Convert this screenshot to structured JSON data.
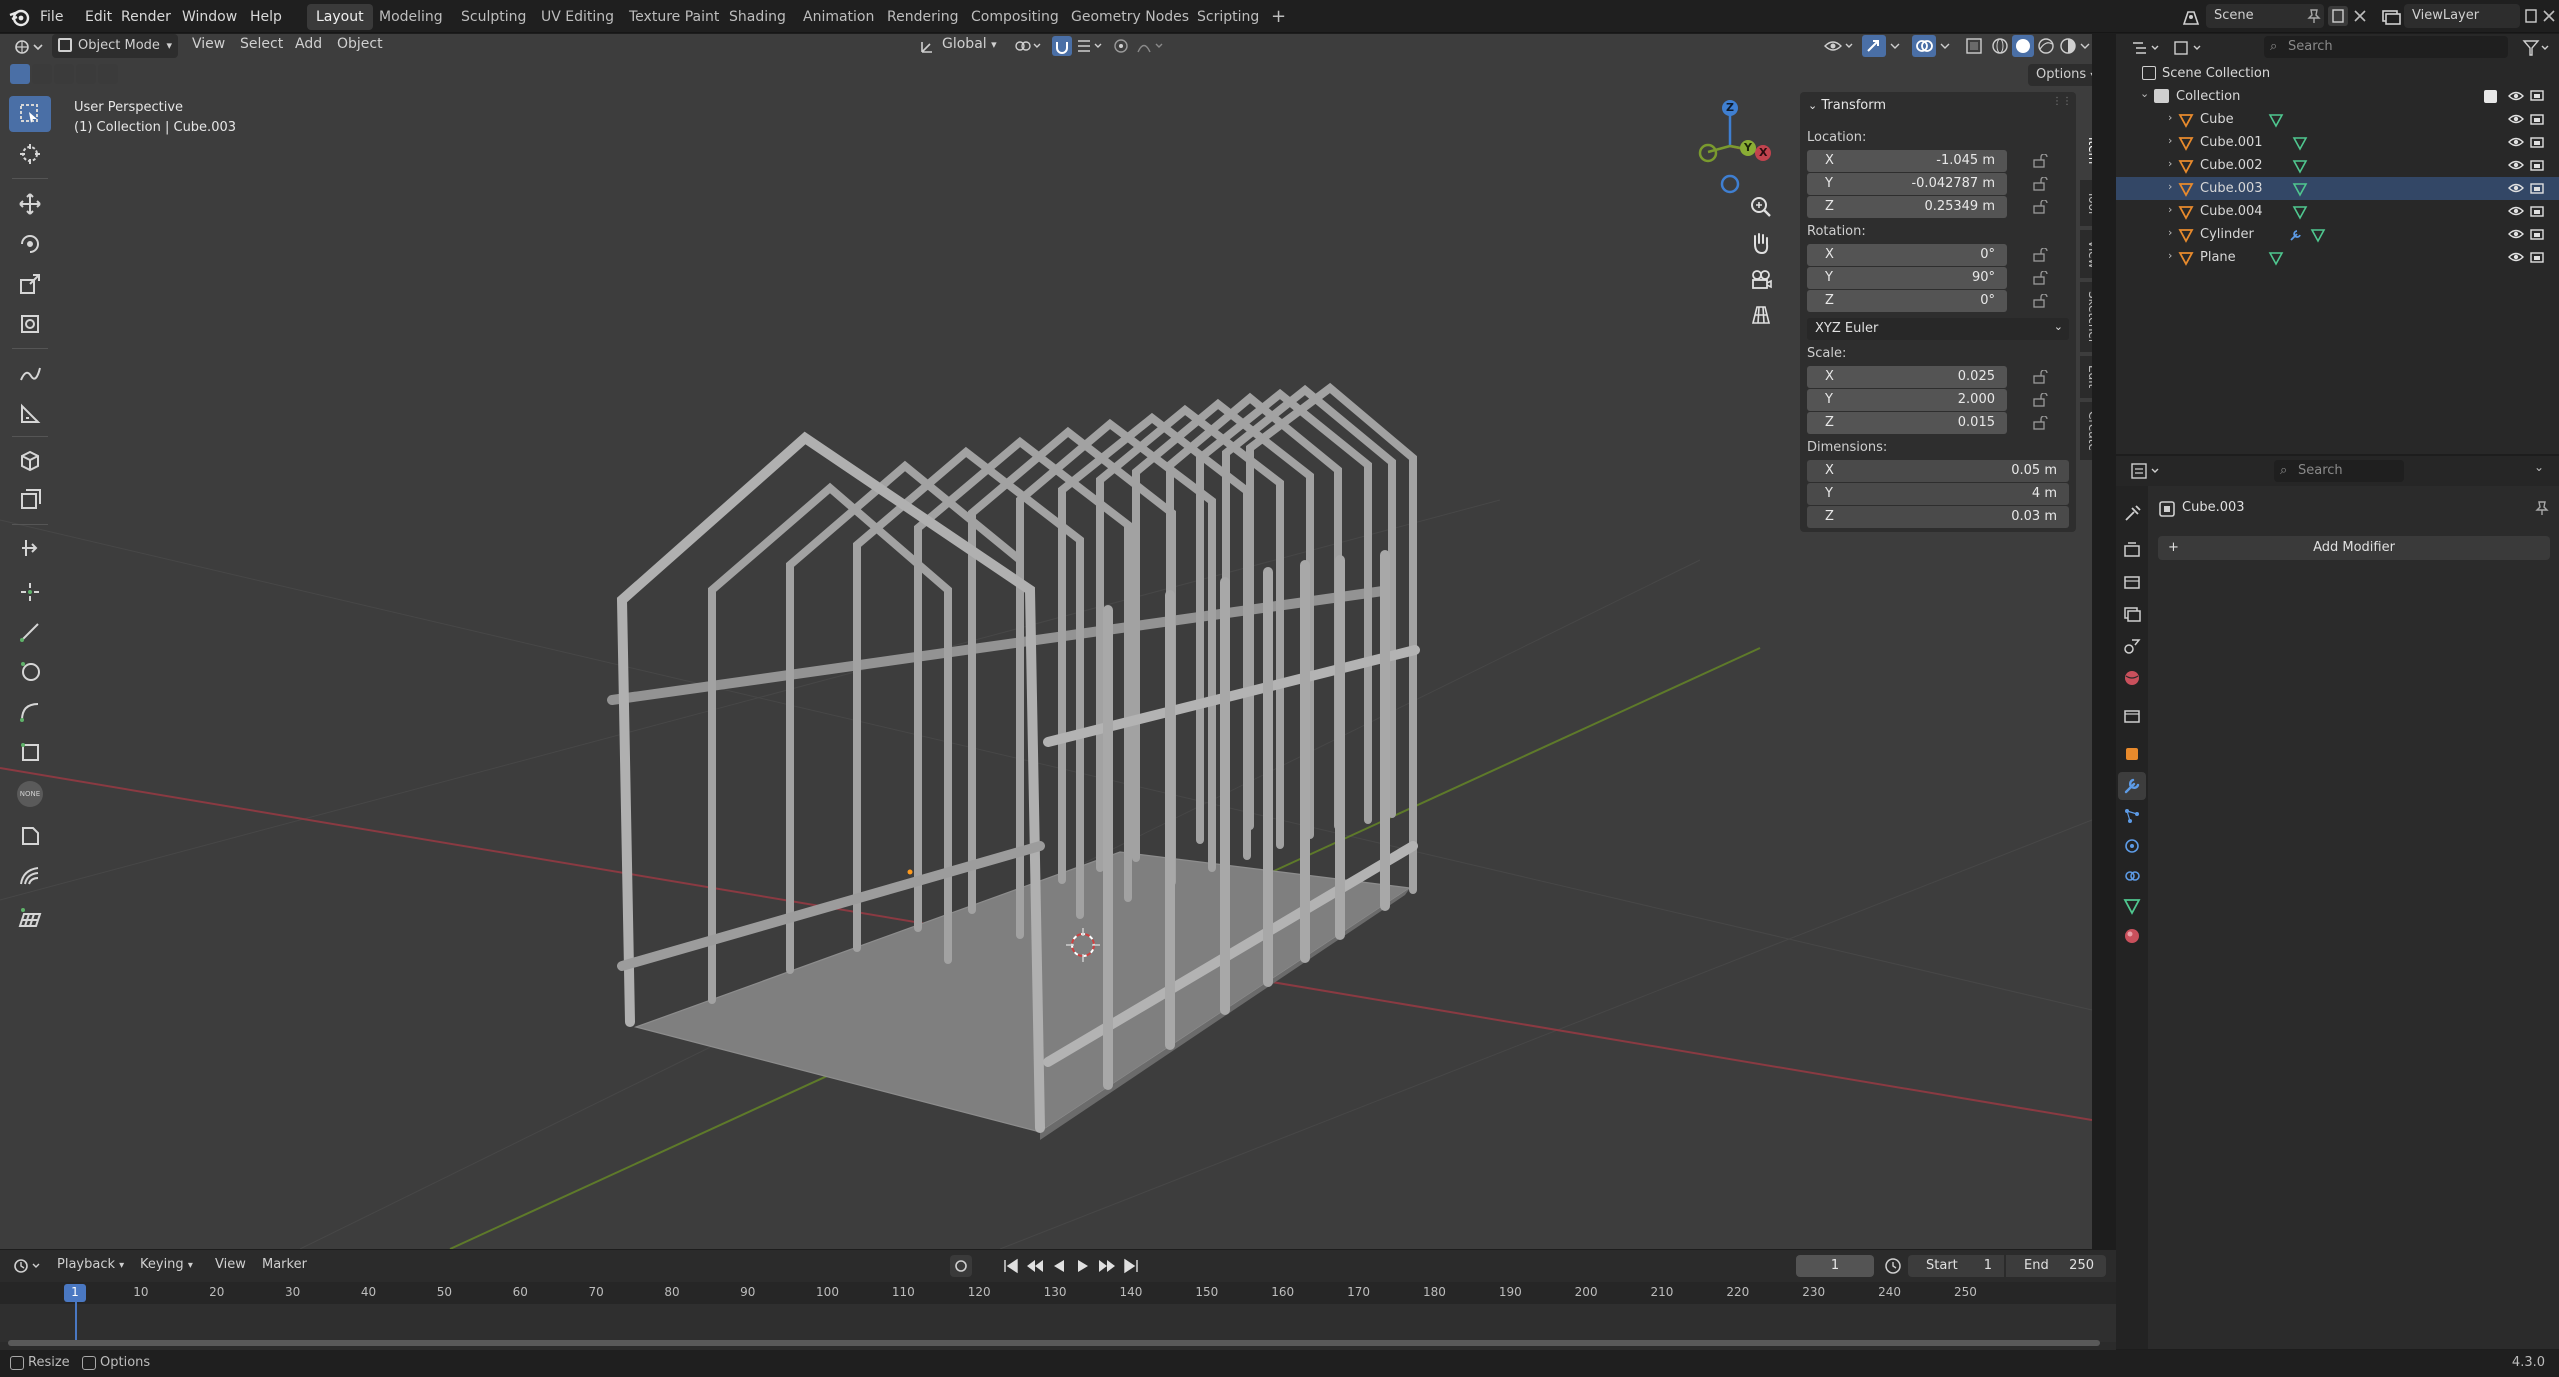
{
  "topbar": {
    "menus": [
      "File",
      "Edit",
      "Render",
      "Window",
      "Help"
    ],
    "workspaces": [
      "Layout",
      "Modeling",
      "Sculpting",
      "UV Editing",
      "Texture Paint",
      "Shading",
      "Animation",
      "Rendering",
      "Compositing",
      "Geometry Nodes",
      "Scripting"
    ],
    "active_workspace": "Layout",
    "add_tab": "+",
    "scene": "Scene",
    "view_layer": "ViewLayer"
  },
  "viewport_header": {
    "mode": "Object Mode",
    "menus": [
      "View",
      "Select",
      "Add",
      "Object"
    ],
    "transform_orientation": "Global",
    "options": "Options"
  },
  "viewport": {
    "perspective_label": "User Perspective",
    "collection_label": "(1) Collection | Cube.003",
    "gizmo": {
      "x": "X",
      "y": "Y",
      "z": "Z"
    }
  },
  "npanel": {
    "section": "Transform",
    "location_label": "Location:",
    "location": [
      {
        "axis": "X",
        "value": "-1.045 m"
      },
      {
        "axis": "Y",
        "value": "-0.042787 m"
      },
      {
        "axis": "Z",
        "value": "0.25349 m"
      }
    ],
    "rotation_label": "Rotation:",
    "rotation": [
      {
        "axis": "X",
        "value": "0°"
      },
      {
        "axis": "Y",
        "value": "90°"
      },
      {
        "axis": "Z",
        "value": "0°"
      }
    ],
    "rotation_mode": "XYZ Euler",
    "scale_label": "Scale:",
    "scale": [
      {
        "axis": "X",
        "value": "0.025"
      },
      {
        "axis": "Y",
        "value": "2.000"
      },
      {
        "axis": "Z",
        "value": "0.015"
      }
    ],
    "dimensions_label": "Dimensions:",
    "dimensions": [
      {
        "axis": "X",
        "value": "0.05 m"
      },
      {
        "axis": "Y",
        "value": "4 m"
      },
      {
        "axis": "Z",
        "value": "0.03 m"
      }
    ],
    "tabs": [
      "Item",
      "Tool",
      "View",
      "Sketcher",
      "Edit",
      "Create"
    ],
    "active_tab": "Item"
  },
  "outliner": {
    "search_placeholder": "Search",
    "scene_collection": "Scene Collection",
    "collection": "Collection",
    "objects": [
      "Cube",
      "Cube.001",
      "Cube.002",
      "Cube.003",
      "Cube.004",
      "Cylinder",
      "Plane"
    ],
    "selected": "Cube.003"
  },
  "properties": {
    "search_placeholder": "Search",
    "object_name": "Cube.003",
    "add_modifier": "Add Modifier"
  },
  "timeline": {
    "menus": [
      "Playback",
      "Keying",
      "View",
      "Marker"
    ],
    "current_frame": "1",
    "start_label": "Start",
    "start": "1",
    "end_label": "End",
    "end": "250",
    "ruler": [
      "1",
      "10",
      "20",
      "30",
      "40",
      "50",
      "60",
      "70",
      "80",
      "90",
      "100",
      "110",
      "120",
      "130",
      "140",
      "150",
      "160",
      "170",
      "180",
      "190",
      "200",
      "210",
      "220",
      "230",
      "240",
      "250"
    ]
  },
  "statusbar": {
    "left1": "Resize",
    "left2": "Options",
    "version": "4.3.0"
  },
  "colors": {
    "accent": "#4a6fa6",
    "viewport_bg": "#3d3d3d",
    "x_axis": "#c2434e",
    "y_axis": "#7a9a2e",
    "z_axis": "#3f7fd1",
    "mesh": "#a9a9a9"
  }
}
